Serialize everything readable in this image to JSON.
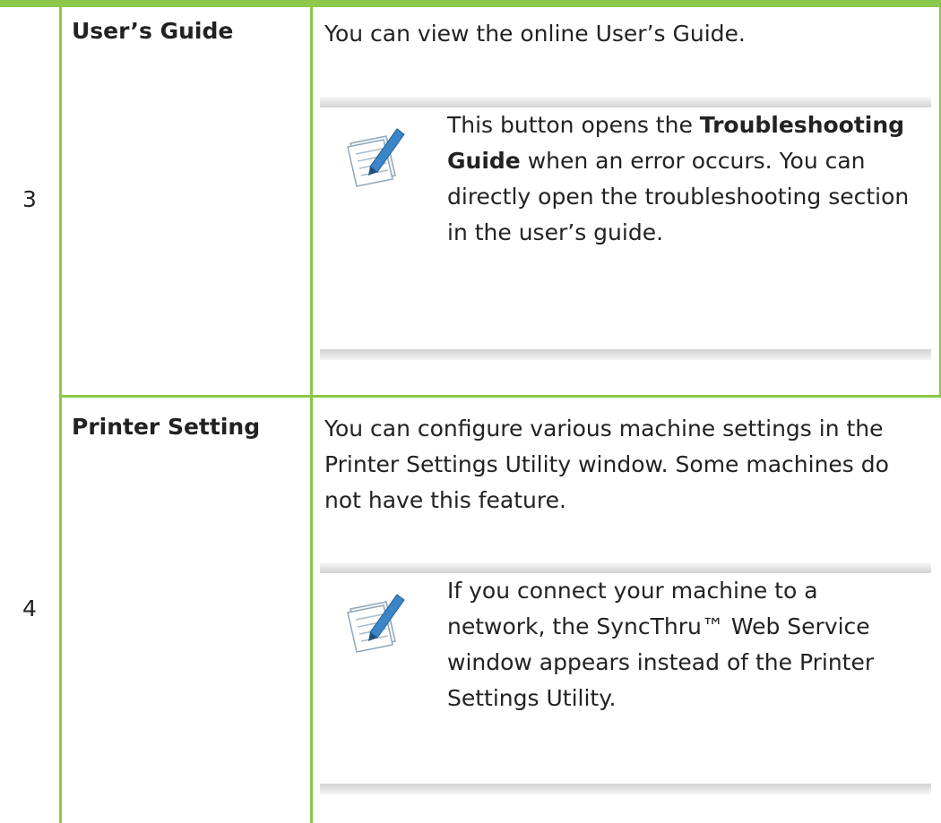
{
  "rows": [
    {
      "number": "3",
      "feature": "User’s Guide",
      "description": "You can view the online User’s Guide.",
      "note": {
        "icon": "note-pencil-icon",
        "text_before": "This button opens the ",
        "bold": "Troubleshooting Guide",
        "text_after": " when an error occurs. You can directly open the troubleshooting section in the user’s guide."
      }
    },
    {
      "number": "4",
      "feature": "Printer Setting",
      "description": "You can configure various machine settings in the Printer Settings Utility window. Some machines do not have this feature.",
      "note": {
        "icon": "note-pencil-icon",
        "text": "If you connect your machine to a network, the SyncThru™ Web Service window appears instead of the Printer Settings Utility."
      }
    }
  ],
  "colors": {
    "rule": "#8cc84b"
  }
}
